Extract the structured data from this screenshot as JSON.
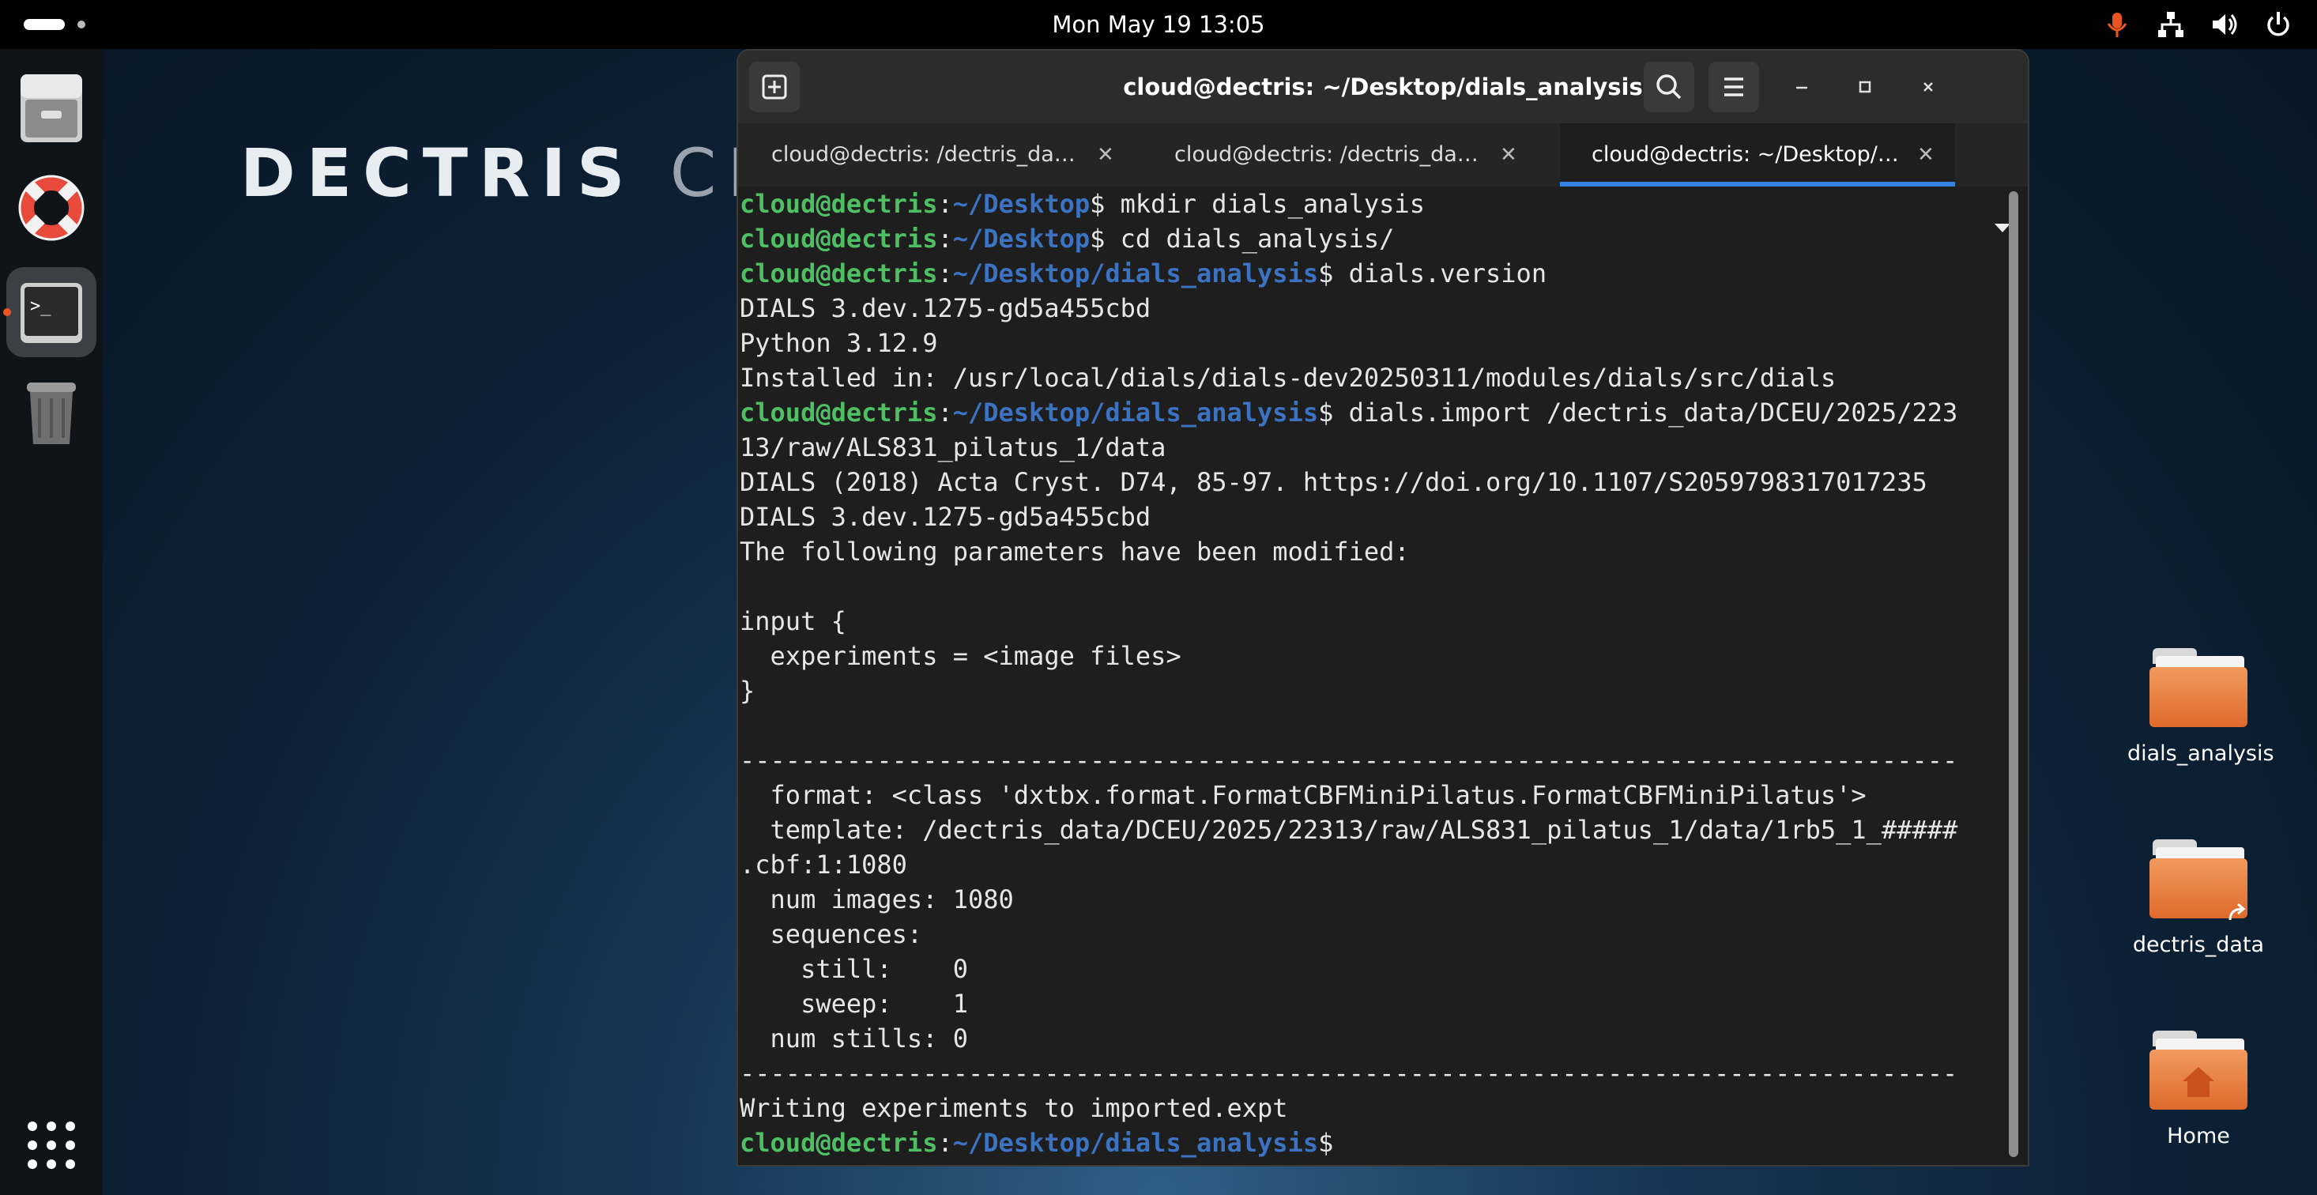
{
  "topbar": {
    "clock": "Mon May 19  13:05",
    "tray_icons": [
      "microphone-icon",
      "network-icon",
      "volume-icon",
      "power-icon"
    ]
  },
  "dock": {
    "items": [
      "files-icon",
      "help-lifebuoy-icon",
      "terminal-icon",
      "trash-icon",
      "app-grid-icon"
    ]
  },
  "desktop": {
    "brand_bold": "DECTRIS",
    "brand_light": "CLO",
    "icons": [
      {
        "label": "dials_analysis",
        "icon": "folder-icon"
      },
      {
        "label": "dectris_data",
        "icon": "folder-link-icon"
      },
      {
        "label": "Home",
        "icon": "home-folder-icon"
      }
    ]
  },
  "terminal": {
    "title": "cloud@dectris: ~/Desktop/dials_analysis",
    "tabs": [
      {
        "label": "cloud@dectris: /dectris_da…",
        "active": false
      },
      {
        "label": "cloud@dectris: /dectris_da…",
        "active": false
      },
      {
        "label": "cloud@dectris: ~/Desktop/…",
        "active": true
      }
    ],
    "lines": [
      {
        "user": "cloud@dectris",
        "sep": ":",
        "path": "~/Desktop",
        "cmd": "$ mkdir dials_analysis"
      },
      {
        "user": "cloud@dectris",
        "sep": ":",
        "path": "~/Desktop",
        "cmd": "$ cd dials_analysis/"
      },
      {
        "user": "cloud@dectris",
        "sep": ":",
        "path": "~/Desktop/dials_analysis",
        "cmd": "$ dials.version"
      },
      {
        "text": "DIALS 3.dev.1275-gd5a455cbd"
      },
      {
        "text": "Python 3.12.9"
      },
      {
        "text": "Installed in: /usr/local/dials/dials-dev20250311/modules/dials/src/dials"
      },
      {
        "user": "cloud@dectris",
        "sep": ":",
        "path": "~/Desktop/dials_analysis",
        "cmd": "$ dials.import /dectris_data/DCEU/2025/223"
      },
      {
        "text": "13/raw/ALS831_pilatus_1/data"
      },
      {
        "text": "DIALS (2018) Acta Cryst. D74, 85-97. https://doi.org/10.1107/S2059798317017235"
      },
      {
        "text": "DIALS 3.dev.1275-gd5a455cbd"
      },
      {
        "text": "The following parameters have been modified:"
      },
      {
        "text": ""
      },
      {
        "text": "input {"
      },
      {
        "text": "  experiments = <image files>"
      },
      {
        "text": "}"
      },
      {
        "text": ""
      },
      {
        "text": "--------------------------------------------------------------------------------"
      },
      {
        "text": "  format: <class 'dxtbx.format.FormatCBFMiniPilatus.FormatCBFMiniPilatus'>"
      },
      {
        "text": "  template: /dectris_data/DCEU/2025/22313/raw/ALS831_pilatus_1/data/1rb5_1_#####"
      },
      {
        "text": ".cbf:1:1080"
      },
      {
        "text": "  num images: 1080"
      },
      {
        "text": "  sequences:"
      },
      {
        "text": "    still:    0"
      },
      {
        "text": "    sweep:    1"
      },
      {
        "text": "  num stills: 0"
      },
      {
        "text": "--------------------------------------------------------------------------------"
      },
      {
        "text": "Writing experiments to imported.expt"
      },
      {
        "user": "cloud@dectris",
        "sep": ":",
        "path": "~/Desktop/dials_analysis",
        "cmd": "$"
      }
    ]
  }
}
